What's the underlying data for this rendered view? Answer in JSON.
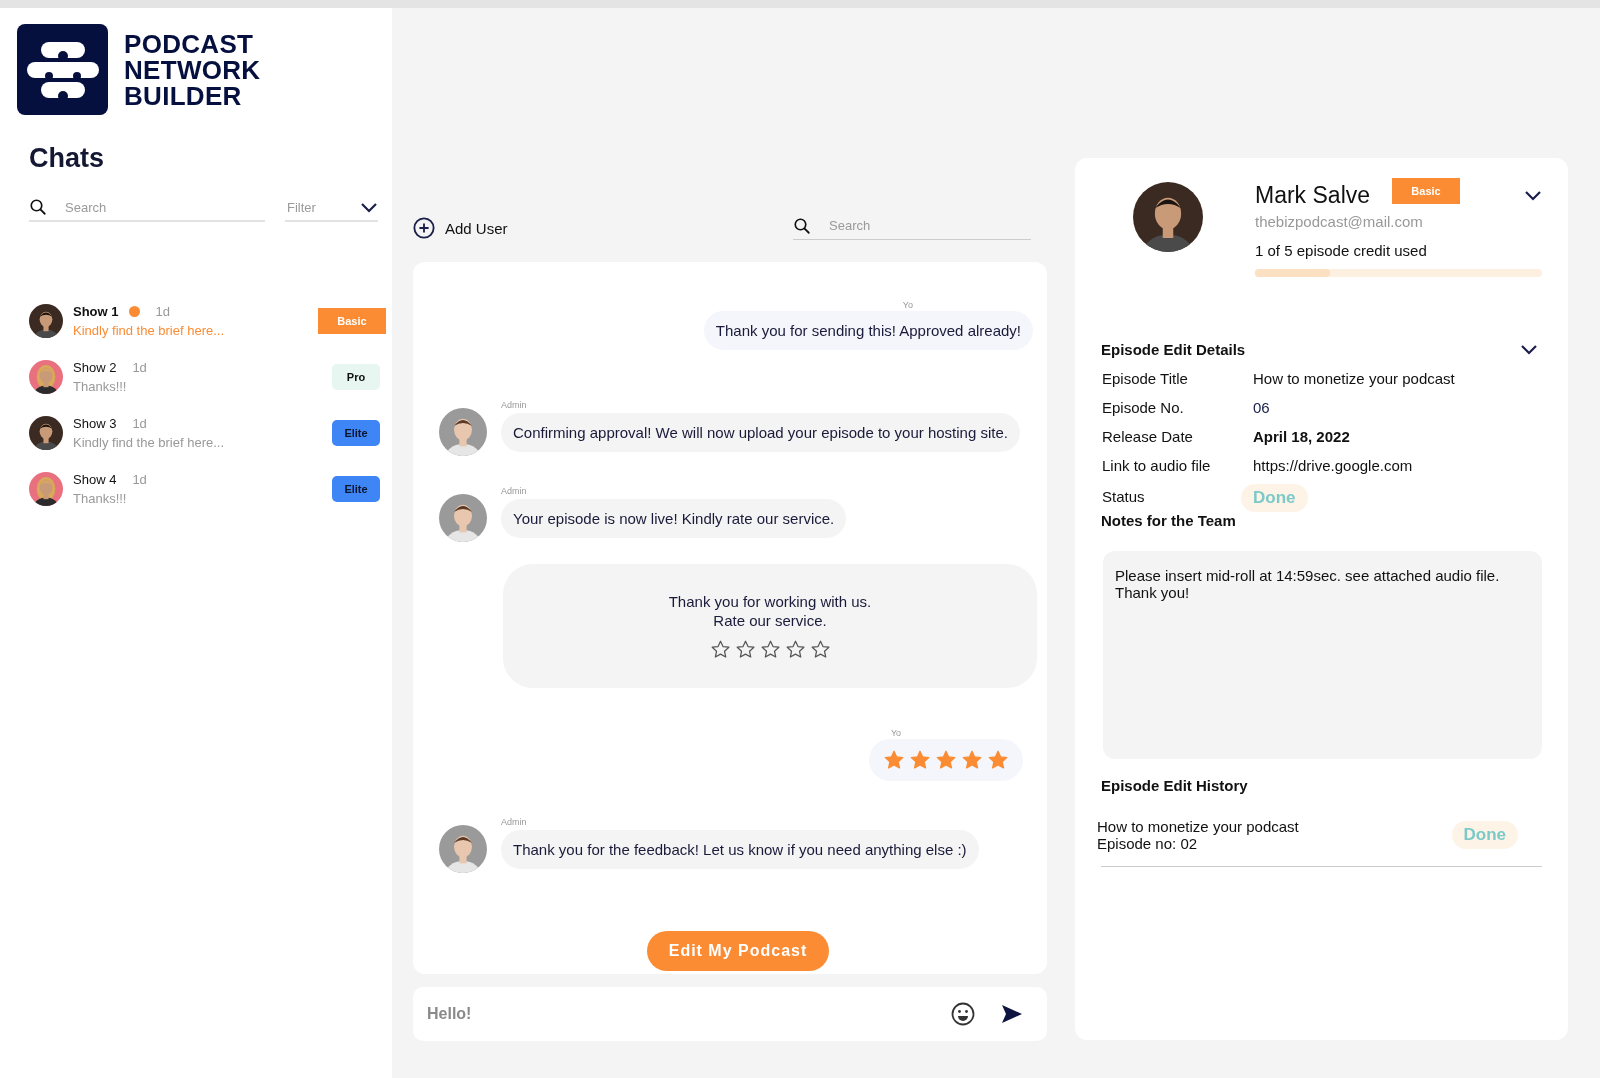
{
  "brand": {
    "lines": [
      "PODCAST",
      "NETWORK",
      "BUILDER"
    ]
  },
  "sidebar": {
    "title": "Chats",
    "search": {
      "placeholder": "Search"
    },
    "filter": {
      "placeholder": "Filter"
    },
    "chats": [
      {
        "name": "Show 1",
        "time": "1d",
        "preview": "Kindly find the brief here...",
        "unread": true,
        "badge": {
          "label": "Basic",
          "kind": "basic"
        }
      },
      {
        "name": "Show 2",
        "time": "1d",
        "preview": "Thanks!!!",
        "unread": false,
        "badge": {
          "label": "Pro",
          "kind": "pro"
        }
      },
      {
        "name": "Show 3",
        "time": "1d",
        "preview": "Kindly find the brief here...",
        "unread": false,
        "badge": {
          "label": "Elite",
          "kind": "elite"
        }
      },
      {
        "name": "Show 4",
        "time": "1d",
        "preview": "Thanks!!!",
        "unread": false,
        "badge": {
          "label": "Elite",
          "kind": "elite"
        }
      }
    ]
  },
  "chat": {
    "add_user": "Add User",
    "search": {
      "placeholder": "Search"
    },
    "messages": [
      {
        "kind": "outgoing",
        "sender": "Yo",
        "text": "Thank you for sending this! Approved already!"
      },
      {
        "kind": "incoming",
        "sender": "Admin",
        "text": "Confirming approval! We will now upload your episode to your hosting site."
      },
      {
        "kind": "incoming",
        "sender": "Admin",
        "text": "Your episode is now live! Kindly rate our service."
      },
      {
        "kind": "rating_prompt",
        "lines": [
          "Thank you for working with us.",
          "Rate our service."
        ],
        "stars": 0
      },
      {
        "kind": "rating",
        "sender": "Yo",
        "stars": 5
      },
      {
        "kind": "incoming",
        "sender": "Admin",
        "text": "Thank you for the feedback! Let us know if you need anything else :)"
      }
    ],
    "action_button": "Edit My Podcast",
    "composer": {
      "placeholder": "Hello!"
    }
  },
  "profile": {
    "name": "Mark Salve",
    "plan": "Basic",
    "email": "thebizpodcast@mail.com",
    "credits": "1 of 5 episode credit used",
    "level": 0.26,
    "expanded": false
  },
  "details": {
    "title": "Episode Edit Details",
    "expanded": false,
    "rows": [
      {
        "label": "Episode Title",
        "value": "How to monetize your podcast",
        "kind": "text"
      },
      {
        "label": "Episode No.",
        "value": "06",
        "kind": "number"
      },
      {
        "label": "Release Date",
        "value": "April 18, 2022",
        "kind": "bold"
      },
      {
        "label": "Link to audio file",
        "value": "https://drive.google.com",
        "kind": "text"
      },
      {
        "label": "Status",
        "value": "Done",
        "kind": "status"
      }
    ],
    "notes_title": "Notes for the Team",
    "notes_lines": [
      "Please insert mid-roll at 14:59sec. see attached audio file.",
      "Thank you!"
    ],
    "history_title": "Episode Edit History",
    "history": [
      {
        "title": "How to monetize your podcast",
        "episode": "Episode no: 02",
        "status": "Done"
      }
    ]
  }
}
